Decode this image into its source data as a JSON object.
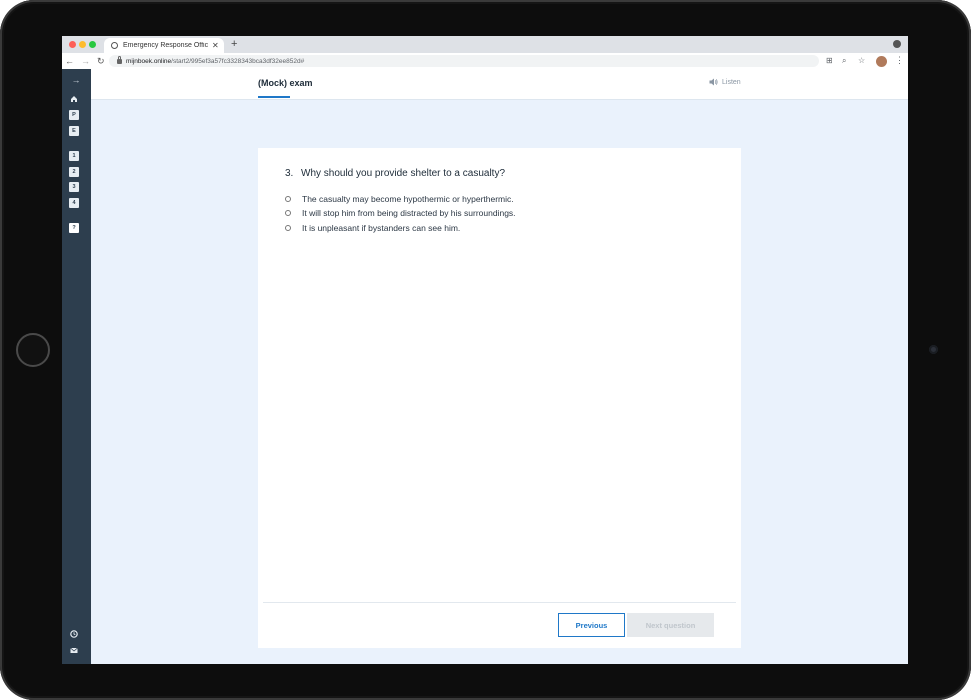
{
  "browser": {
    "tab_title": "Emergency Response Officer (E",
    "new_tab": "+",
    "url_domain": "mijnboek.online",
    "url_path": "/start2/995ef3a57fc3328343bca3df32ee852d#"
  },
  "sidebar": {
    "collapse_icon": "arrow-right-icon",
    "home_icon": "home-icon",
    "p_label": "P",
    "e_label": "E",
    "chapters": [
      "1",
      "2",
      "3",
      "4"
    ],
    "help_label": "?",
    "clock_icon": "clock-icon",
    "mail_icon": "mail-icon"
  },
  "header": {
    "title": "(Mock) exam",
    "listen_label": "Listen"
  },
  "question": {
    "number": "3.",
    "text": "Why should you provide shelter to a casualty?",
    "options": [
      "The casualty may become hypothermic or hyperthermic.",
      "It will stop him from being distracted by his surroundings.",
      "It is unpleasant if bystanders can see him."
    ]
  },
  "footer": {
    "previous_label": "Previous",
    "next_label": "Next question"
  },
  "colors": {
    "accent": "#1f78c8",
    "sidebar_bg": "#2d3e4e",
    "page_bg": "#eaf2fc"
  }
}
